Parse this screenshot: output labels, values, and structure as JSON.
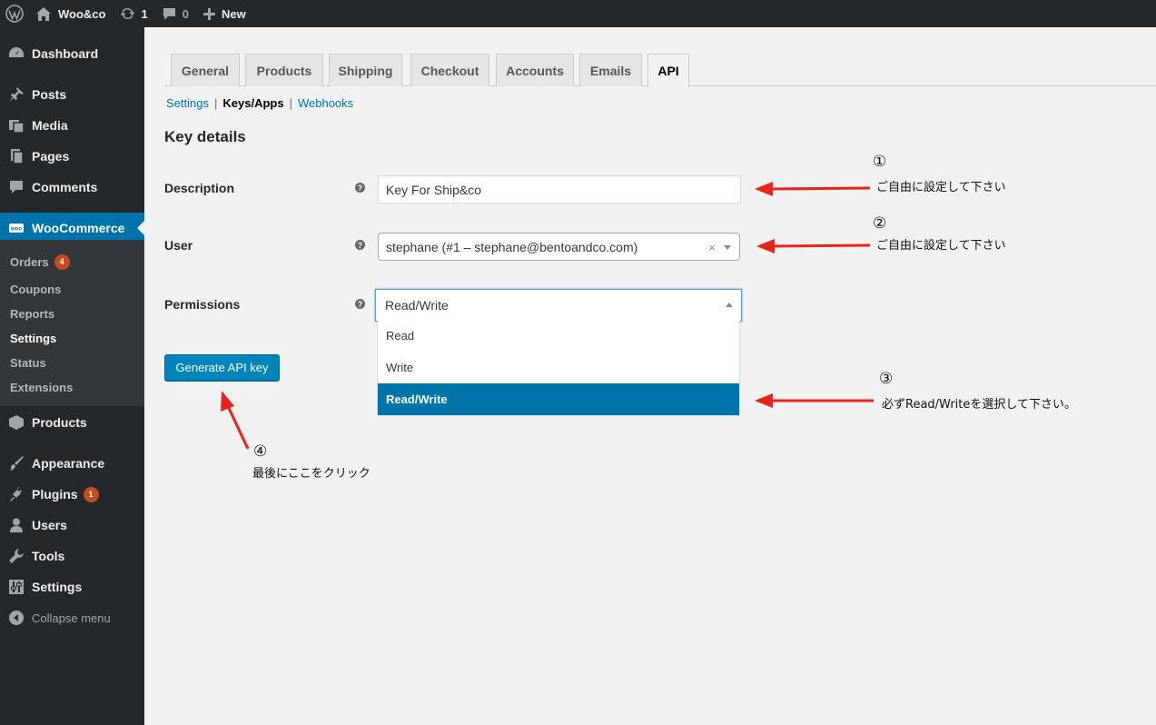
{
  "admin_bar": {
    "site_name": "Woo&co",
    "updates_count": "1",
    "comments_count": "0",
    "new_label": "New"
  },
  "sidebar": {
    "dashboard": "Dashboard",
    "posts": "Posts",
    "media": "Media",
    "pages": "Pages",
    "comments": "Comments",
    "woocommerce": "WooCommerce",
    "woo_submenu": {
      "orders": "Orders",
      "orders_badge": "4",
      "coupons": "Coupons",
      "reports": "Reports",
      "settings": "Settings",
      "status": "Status",
      "extensions": "Extensions"
    },
    "products": "Products",
    "appearance": "Appearance",
    "plugins": "Plugins",
    "plugins_badge": "1",
    "users": "Users",
    "tools": "Tools",
    "settings": "Settings",
    "collapse": "Collapse menu"
  },
  "tabs": [
    "General",
    "Products",
    "Shipping",
    "Checkout",
    "Accounts",
    "Emails",
    "API"
  ],
  "active_tab": "API",
  "subsub": {
    "settings": "Settings",
    "keys_apps": "Keys/Apps",
    "webhooks": "Webhooks",
    "separator": "|"
  },
  "form": {
    "title": "Key details",
    "description_label": "Description",
    "description_value": "Key For Ship&co",
    "user_label": "User",
    "user_value": "stephane (#1 – stephane@bentoandco.com)",
    "permissions_label": "Permissions",
    "permissions_value": "Read/Write",
    "permissions_options": [
      "Read",
      "Write",
      "Read/Write"
    ],
    "help_icon": "?",
    "clear_icon": "×",
    "generate_button": "Generate API key"
  },
  "annotations": {
    "n1": "①",
    "t1": "ご自由に設定して下さい",
    "n2": "②",
    "t2": "ご自由に設定して下さい",
    "n3": "③",
    "t3": "必ずRead/Writeを選択して下さい。",
    "n4": "④",
    "t4": "最後にここをクリック",
    "arrow_color": "#e8231b"
  },
  "colors": {
    "admin_bg": "#23282d",
    "accent": "#0073aa",
    "button": "#0085ba",
    "badge": "#ca4a1f"
  }
}
